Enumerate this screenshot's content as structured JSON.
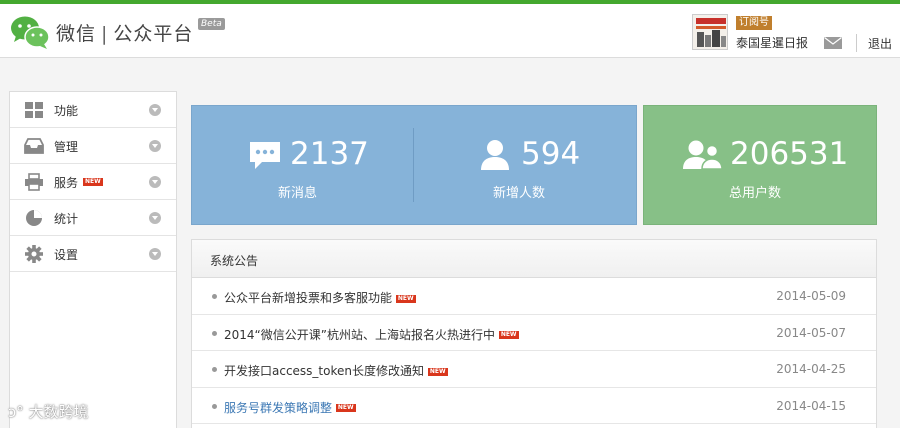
{
  "header": {
    "brand_name": "微信",
    "brand_separator": "|",
    "brand_product": "公众平台",
    "beta_label": "Beta",
    "subscription_badge": "订阅号",
    "account_name": "泰国星暹日报",
    "logout_label": "退出"
  },
  "sidebar": {
    "items": [
      {
        "label": "功能",
        "icon": "grid-icon"
      },
      {
        "label": "管理",
        "icon": "inbox-icon"
      },
      {
        "label": "服务",
        "icon": "printer-icon",
        "badge": "NEW"
      },
      {
        "label": "统计",
        "icon": "pie-chart-icon"
      },
      {
        "label": "设置",
        "icon": "gear-icon"
      }
    ]
  },
  "stats": {
    "new_messages": {
      "value": "2137",
      "label": "新消息"
    },
    "new_followers": {
      "value": "594",
      "label": "新增人数"
    },
    "total_users": {
      "value": "206531",
      "label": "总用户数"
    }
  },
  "notice": {
    "title": "系统公告",
    "new_badge": "NEW",
    "rows": [
      {
        "text": "公众平台新增投票和多客服功能",
        "date": "2014-05-09"
      },
      {
        "text": "2014“微信公开课”杭州站、上海站报名火热进行中",
        "date": "2014-05-07"
      },
      {
        "text": "开发接口access_token长度修改通知",
        "date": "2014-04-25"
      },
      {
        "text": "服务号群发策略调整",
        "date": "2014-04-15"
      }
    ]
  },
  "watermark": "大数跨境",
  "colors": {
    "accent_green": "#44a82e",
    "stat_blue": "#86b3d9",
    "stat_green": "#87c087",
    "new_badge_red": "#d9361c",
    "link_blue": "#3c78b4"
  }
}
